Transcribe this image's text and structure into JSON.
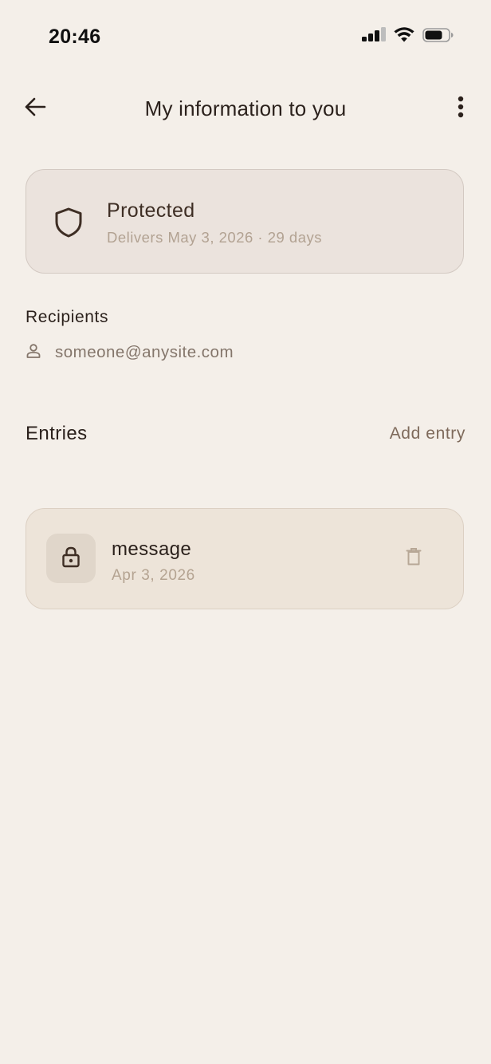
{
  "status_bar": {
    "time": "20:46",
    "icons": [
      "cellular-signal-icon",
      "wifi-icon",
      "battery-icon"
    ]
  },
  "app_bar": {
    "title": "My information to you",
    "back_icon": "arrow-left-icon",
    "more_icon": "more-vertical-icon"
  },
  "status_card": {
    "icon": "shield-icon",
    "title": "Protected",
    "subtitle": "Delivers May 3, 2026 · 29 days"
  },
  "recipients": {
    "label": "Recipients",
    "items": [
      {
        "icon": "person-icon",
        "email": "someone@anysite.com"
      }
    ]
  },
  "entries": {
    "label": "Entries",
    "add_label": "Add entry",
    "items": [
      {
        "icon": "lock-icon",
        "name": "message",
        "date": "Apr 3, 2026",
        "action_icon": "trash-icon"
      }
    ]
  },
  "colors": {
    "background": "#F4EFE9",
    "card": "#EBE3DD",
    "entry_card": "#EDE4D9",
    "text_primary": "#2B211C",
    "text_muted": "#B2A292",
    "accent": "#7E6A5B"
  }
}
